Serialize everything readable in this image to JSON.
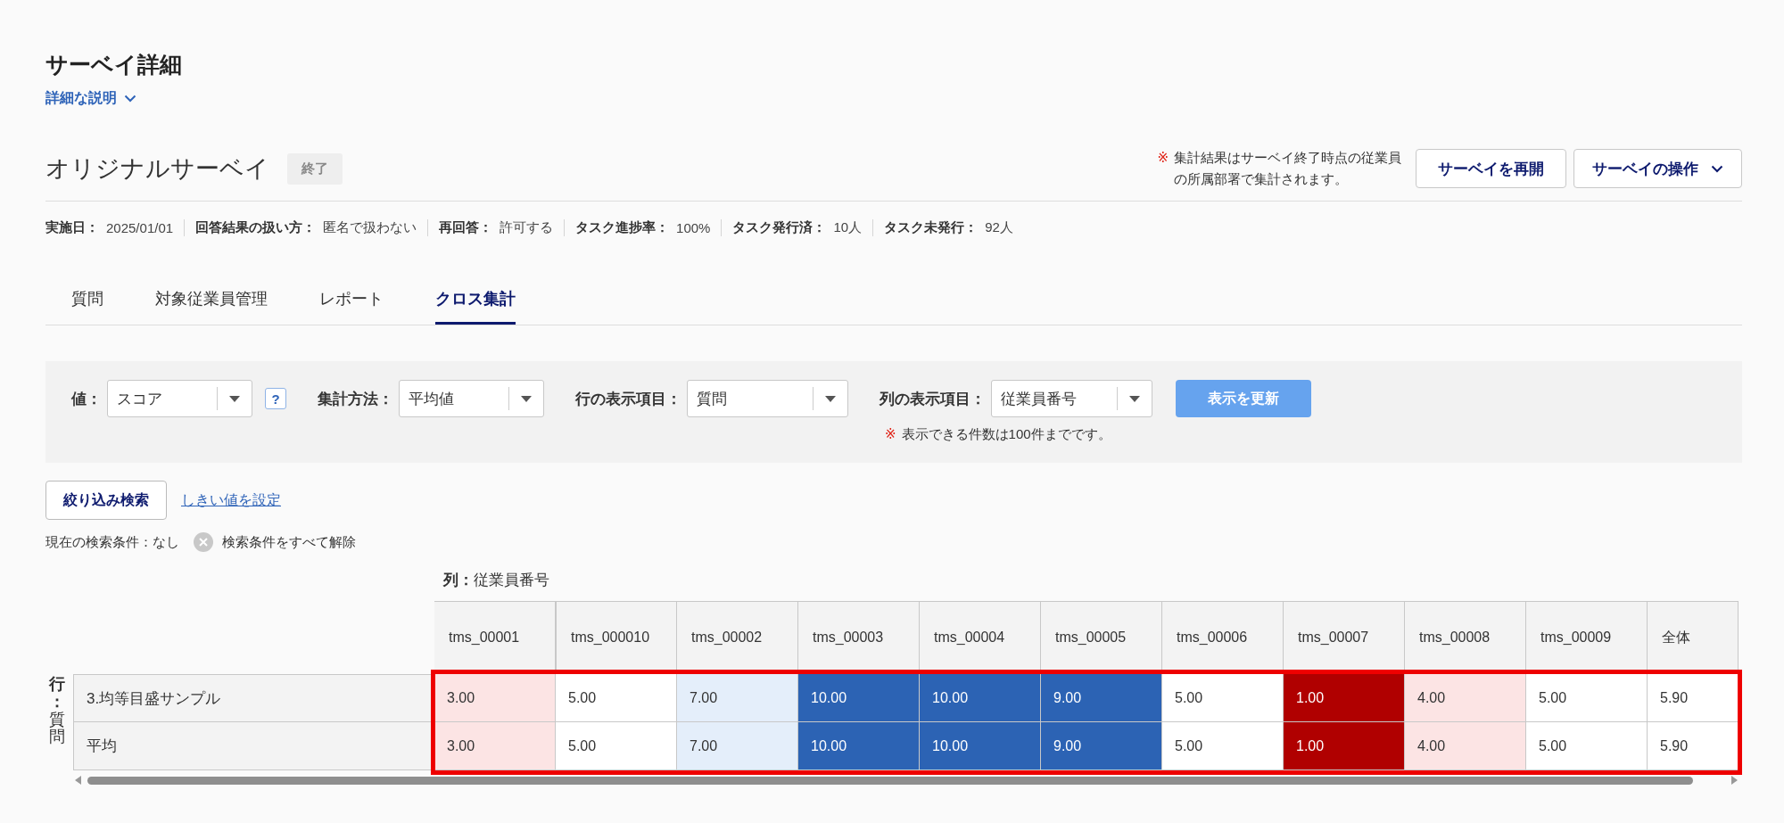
{
  "page_title": "サーベイ詳細",
  "description_toggle": {
    "label": "詳細な説明",
    "expanded": false
  },
  "survey": {
    "name": "オリジナルサーベイ",
    "status": "終了"
  },
  "notice": {
    "mark": "※",
    "lines": [
      "集計結果はサーベイ終了時点の従業員",
      "の所属部署で集計されます。"
    ]
  },
  "header_buttons": [
    {
      "label": "サーベイを再開",
      "kind": "plain"
    },
    {
      "label": "サーベイの操作",
      "kind": "dropdown"
    }
  ],
  "meta": [
    {
      "label": "実施日：",
      "value": "2025/01/01"
    },
    {
      "label": "回答結果の扱い方：",
      "value": "匿名で扱わない"
    },
    {
      "label": "再回答：",
      "value": "許可する"
    },
    {
      "label": "タスク進捗率：",
      "value": "100%"
    },
    {
      "label": "タスク発行済：",
      "value": "10人"
    },
    {
      "label": "タスク未発行：",
      "value": "92人"
    }
  ],
  "tabs": [
    {
      "label": "質問",
      "selected": false
    },
    {
      "label": "対象従業員管理",
      "selected": false
    },
    {
      "label": "レポート",
      "selected": false
    },
    {
      "label": "クロス集計",
      "selected": true
    }
  ],
  "filters": {
    "fields": [
      {
        "label": "値：",
        "value": "スコア",
        "help": "?"
      },
      {
        "label": "集計方法：",
        "value": "平均値"
      },
      {
        "label": "行の表示項目：",
        "value": "質問"
      },
      {
        "label": "列の表示項目：",
        "value": "従業員番号",
        "note_mark": "※",
        "note": "表示できる件数は100件までです。"
      }
    ],
    "update_button": "表示を更新"
  },
  "search_button": "絞り込み検索",
  "threshold_link": "しきい値を設定",
  "conditions": {
    "text": "現在の検索条件：なし",
    "clear_label": "検索条件をすべて解除"
  },
  "table": {
    "column_axis": "**列：**従業員番号",
    "row_axis": "**行：**質問",
    "highlighted": true,
    "columns": [
      "tms_00001",
      "tms_000010",
      "tms_00002",
      "tms_00003",
      "tms_00004",
      "tms_00005",
      "tms_00006",
      "tms_00007",
      "tms_00008",
      "tms_00009",
      "全体"
    ],
    "rows": [
      {
        "label": "3.均等目盛サンプル",
        "cells": [
          {
            "value": "3.00",
            "color": "#fce4e4"
          },
          {
            "value": "5.00",
            "color": "#ffffff"
          },
          {
            "value": "7.00",
            "color": "#e4eefa"
          },
          {
            "value": "10.00",
            "color": "#2c63b4"
          },
          {
            "value": "10.00",
            "color": "#2c63b4"
          },
          {
            "value": "9.00",
            "color": "#2c63b4"
          },
          {
            "value": "5.00",
            "color": "#ffffff"
          },
          {
            "value": "1.00",
            "color": "#b00000"
          },
          {
            "value": "4.00",
            "color": "#fce4e4"
          },
          {
            "value": "5.00",
            "color": "#ffffff"
          },
          {
            "value": "5.90",
            "color": "#ffffff"
          }
        ]
      },
      {
        "label": "平均",
        "cells": [
          {
            "value": "3.00",
            "color": "#fce4e4"
          },
          {
            "value": "5.00",
            "color": "#ffffff"
          },
          {
            "value": "7.00",
            "color": "#e4eefa"
          },
          {
            "value": "10.00",
            "color": "#2c63b4"
          },
          {
            "value": "10.00",
            "color": "#2c63b4"
          },
          {
            "value": "9.00",
            "color": "#2c63b4"
          },
          {
            "value": "5.00",
            "color": "#ffffff"
          },
          {
            "value": "1.00",
            "color": "#b00000"
          },
          {
            "value": "4.00",
            "color": "#fce4e4"
          },
          {
            "value": "5.00",
            "color": "#ffffff"
          },
          {
            "value": "5.90",
            "color": "#ffffff"
          }
        ]
      }
    ]
  }
}
